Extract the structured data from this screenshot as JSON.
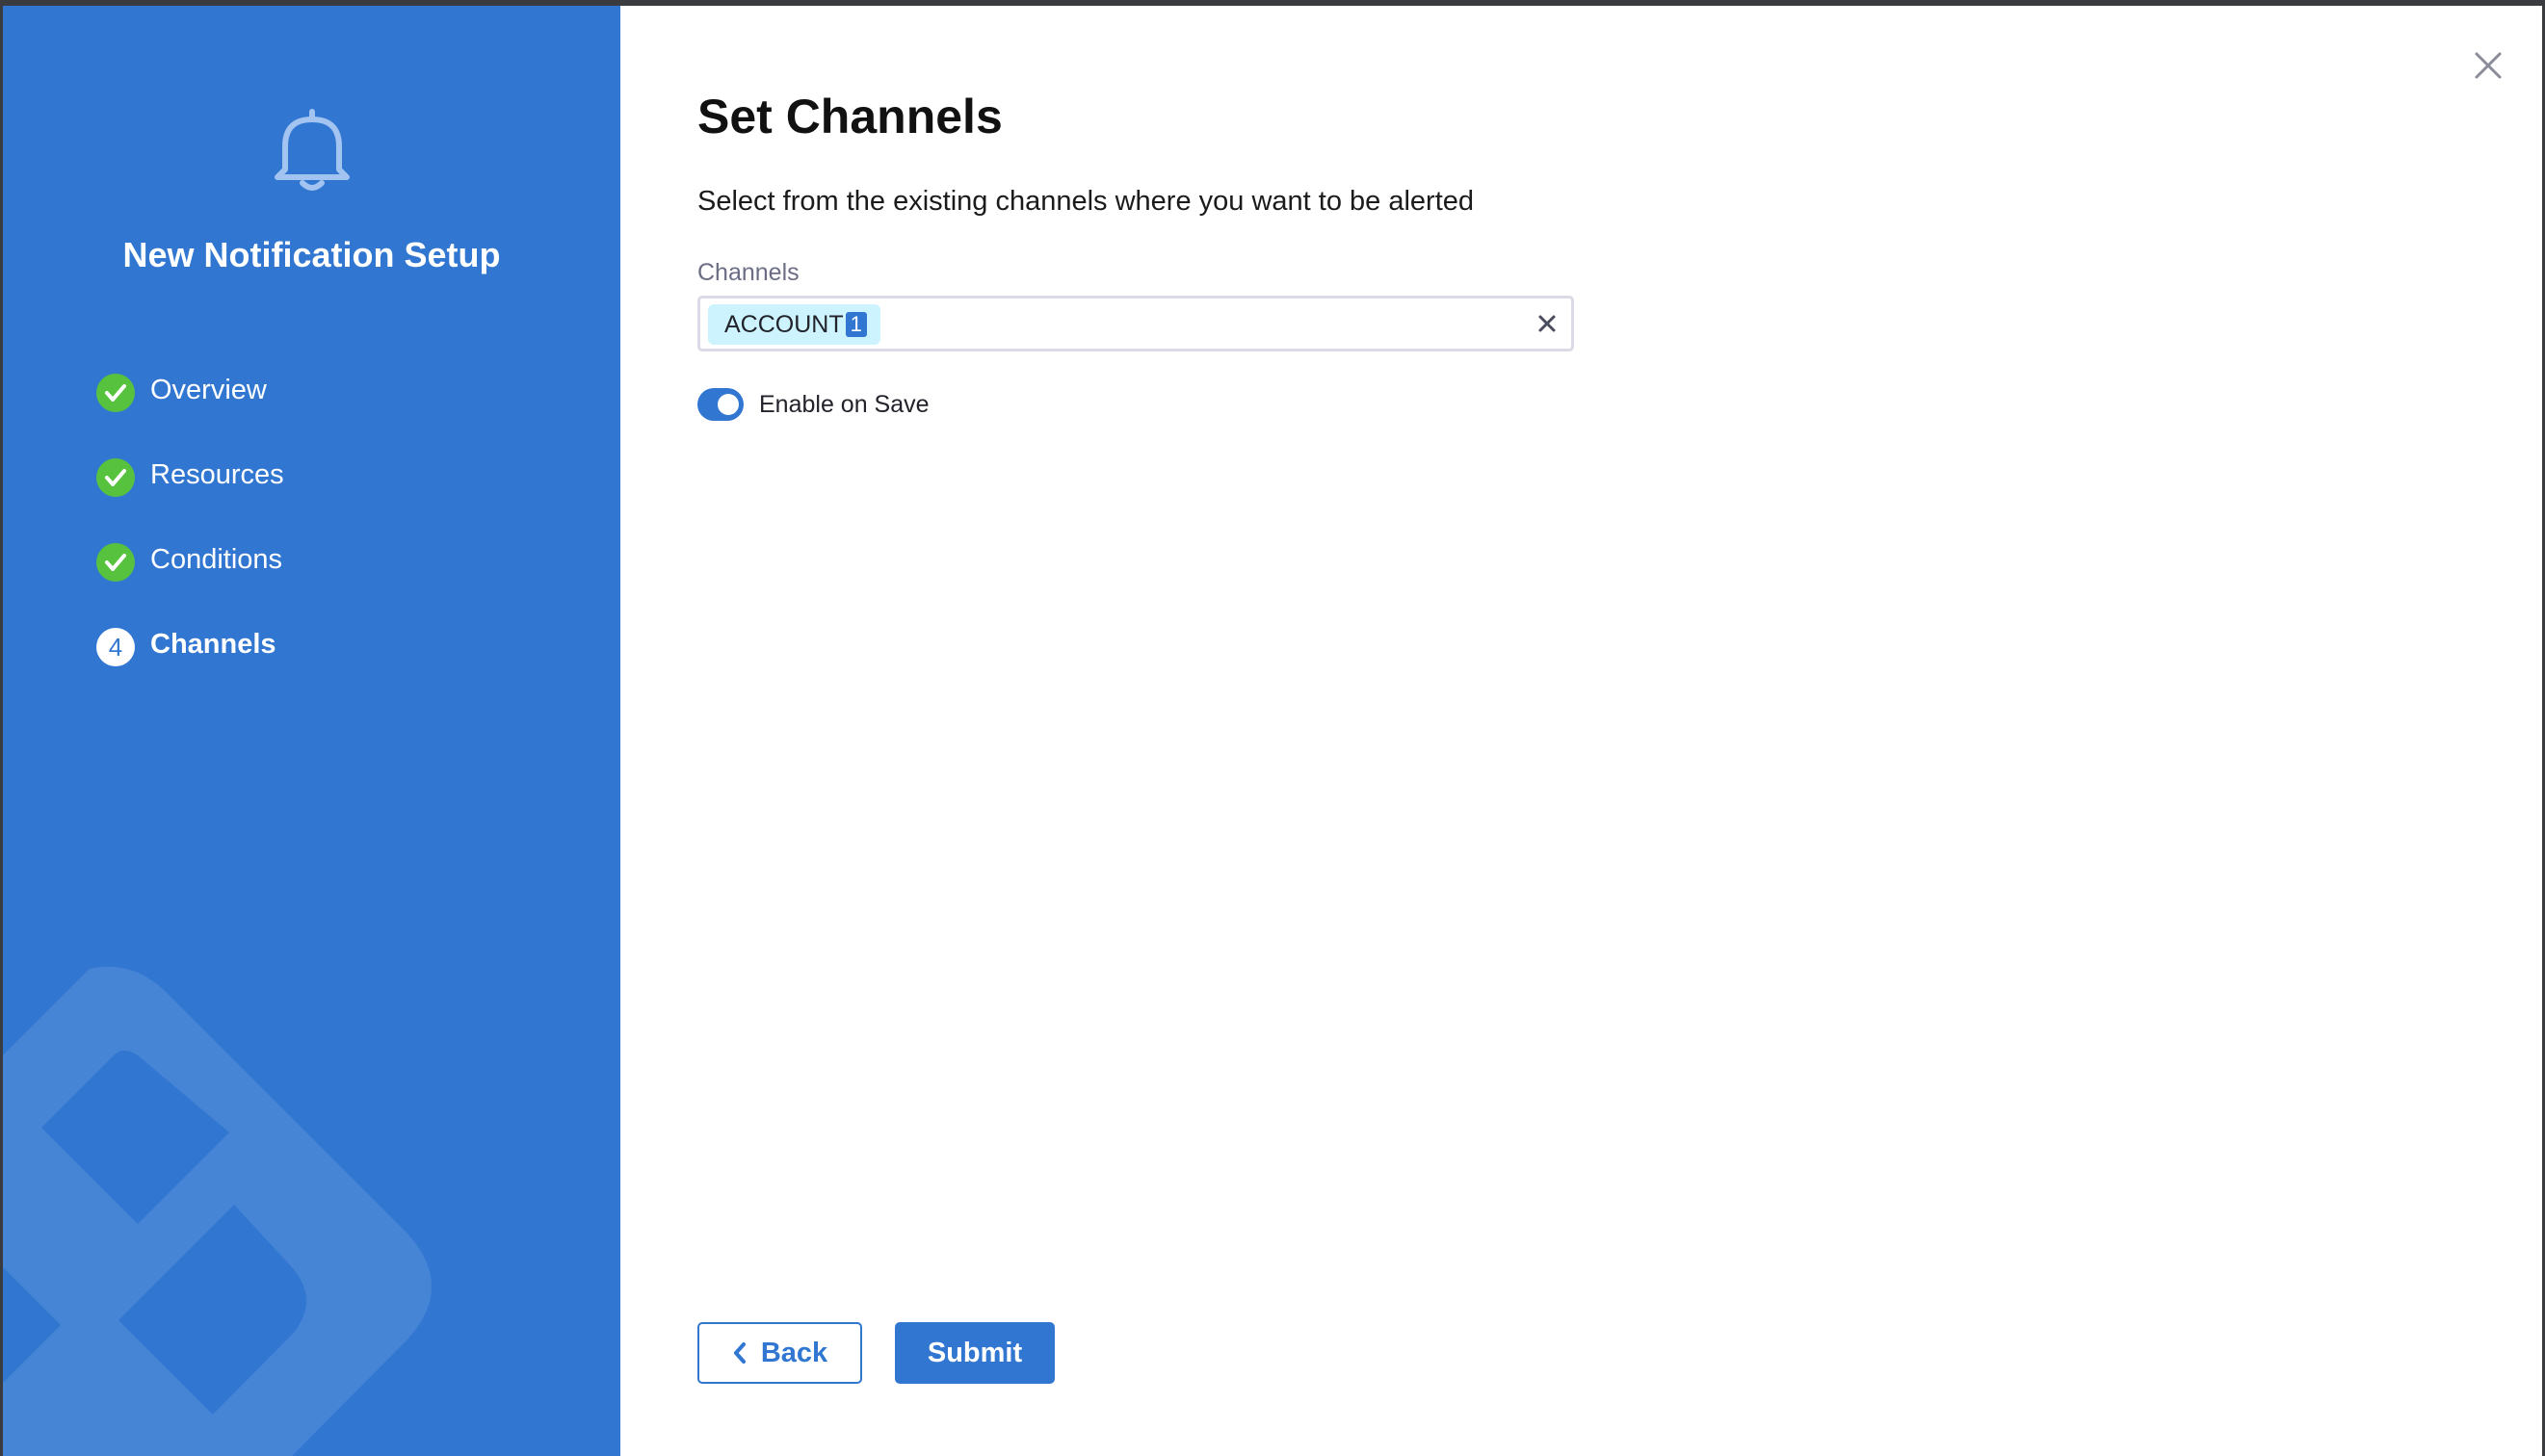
{
  "sidebar": {
    "title": "New Notification Setup",
    "icon": "bell-icon",
    "steps": [
      {
        "label": "Overview",
        "status": "complete"
      },
      {
        "label": "Resources",
        "status": "complete"
      },
      {
        "label": "Conditions",
        "status": "complete"
      },
      {
        "label": "Channels",
        "status": "current",
        "number": "4"
      }
    ]
  },
  "main": {
    "title": "Set Channels",
    "subtitle": "Select from the existing channels where you want to be alerted",
    "channels_field": {
      "label": "Channels",
      "selected_chip": {
        "label": "ACCOUNT",
        "count": "1"
      }
    },
    "enable_on_save": {
      "label": "Enable on Save",
      "checked": true
    },
    "back_label": "Back",
    "submit_label": "Submit"
  },
  "colors": {
    "accent": "#3177d1",
    "success": "#56c23d",
    "chip_bg": "#cdf4fe"
  }
}
